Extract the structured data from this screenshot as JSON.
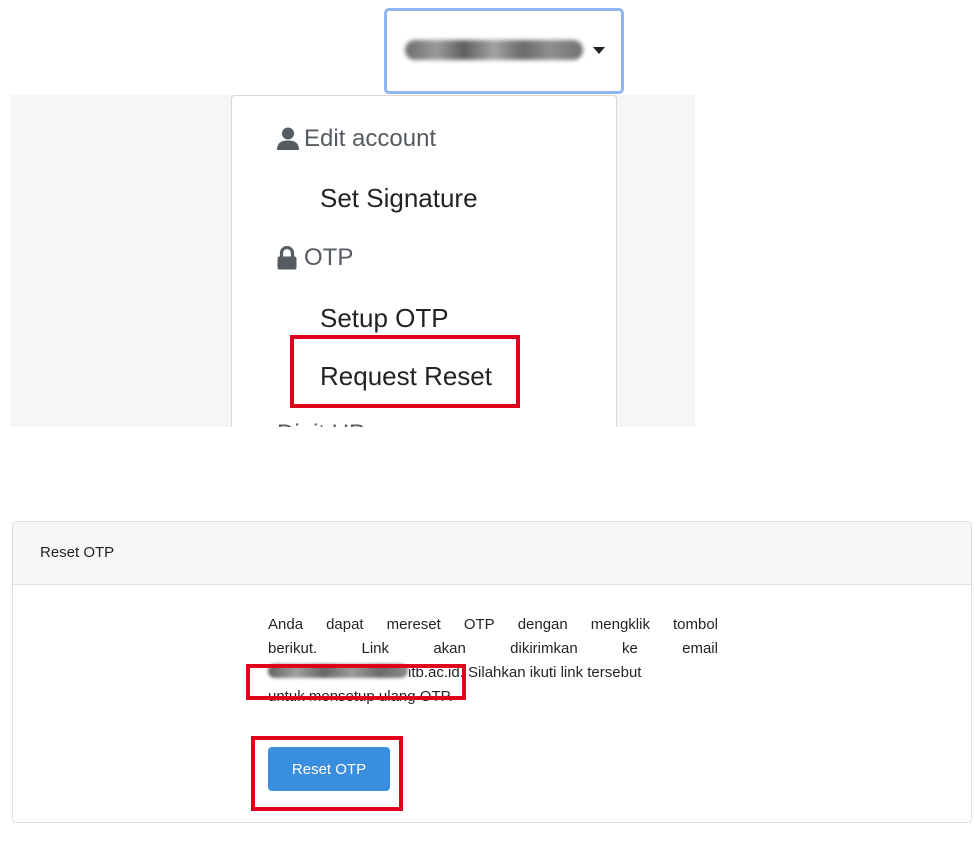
{
  "user_menu": {
    "username_blurred": "",
    "sections": [
      {
        "header": "Edit account",
        "icon": "user-icon",
        "items": [
          "Set Signature"
        ]
      },
      {
        "header": "OTP",
        "icon": "lock-icon",
        "items": [
          "Setup OTP",
          "Request Reset"
        ]
      }
    ],
    "cut_off_item": "Digit UP"
  },
  "reset_card": {
    "title": "Reset OTP",
    "message": {
      "line1": [
        "Anda",
        "dapat",
        "mereset",
        "OTP",
        "dengan",
        "mengklik",
        "tombol"
      ],
      "line2": [
        "berikut.",
        "Link",
        "akan",
        "dikirimkan",
        "ke",
        "email"
      ],
      "email_visible_suffix": "itb.ac.id",
      "line3_rest": ". Silahkan ikuti link tersebut",
      "line4": "untuk mensetup ulang OTP."
    },
    "button_label": "Reset OTP"
  },
  "colors": {
    "highlight": "#e0001b",
    "primary_button": "#3a8ee0",
    "focus_border": "#8fb6f3"
  }
}
